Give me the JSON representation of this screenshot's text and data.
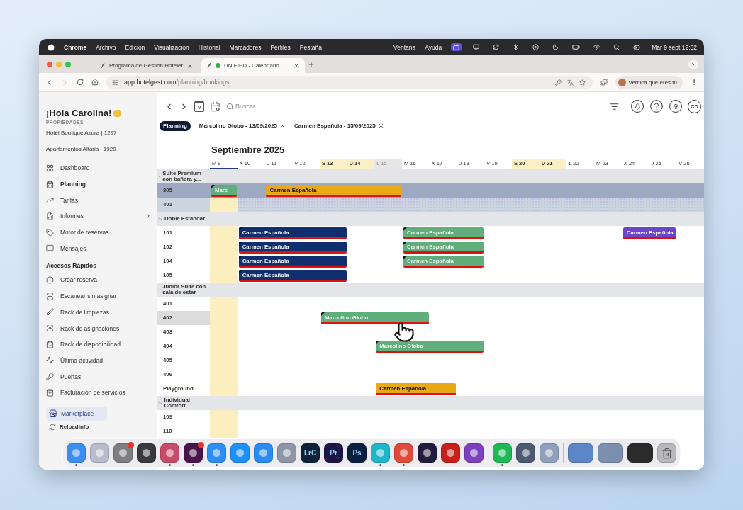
{
  "menu_bar": {
    "app": "Chrome",
    "menus": [
      "Archivo",
      "Edición",
      "Visualización",
      "Historial",
      "Marcadores",
      "Perfiles",
      "Pestaña"
    ],
    "right_menus": [
      "Ventana",
      "Ayuda"
    ],
    "clock": "Mar 9 sept 12:52"
  },
  "browser": {
    "tabs": [
      {
        "title": "Programa de Gestión Hoteler",
        "selected": false
      },
      {
        "title": "UNIFIED - Calendario",
        "selected": true
      }
    ],
    "url_host": "app.hotelgest.com",
    "url_path": "/planning/bookings",
    "profile": "Verifica que eres tú"
  },
  "sidebar": {
    "greeting": "¡Hola Carolina!",
    "section": "PROPIEDADES",
    "properties": [
      "Hotel Boutique Azura | 1297",
      "Apartamentos Altaria | 1920"
    ],
    "nav": [
      {
        "label": "Dashboard",
        "selected": false,
        "submenu": false
      },
      {
        "label": "Planning",
        "selected": true,
        "submenu": false
      },
      {
        "label": "Tarifas",
        "selected": false,
        "submenu": false
      },
      {
        "label": "Informes",
        "selected": false,
        "submenu": true
      },
      {
        "label": "Motor de reservas",
        "selected": false,
        "submenu": false
      },
      {
        "label": "Mensajes",
        "selected": false,
        "submenu": false
      }
    ],
    "quick_title": "Accesos Rápidos",
    "quick": [
      "Crear reserva",
      "Escanear sin asignar",
      "Rack de limpiezas",
      "Rack de asignaciones",
      "Rack de disponibilidad",
      "Última actividad",
      "Puertas",
      "Facturación de servicios"
    ],
    "marketplace": {
      "label": "Marketplace",
      "selected": true
    },
    "reload": "ReloadInfo"
  },
  "toolbar": {
    "calendar_day": "9",
    "search_placeholder": "Buscar...",
    "avatar": "CD"
  },
  "page_tabs": [
    {
      "label": "Planning",
      "selected": true,
      "closable": false
    },
    {
      "label": "Marcolino Globo - 13/09/2025",
      "selected": false,
      "closable": true
    },
    {
      "label": "Carmen Española - 15/09/2025",
      "selected": false,
      "closable": true
    }
  ],
  "calendar": {
    "month": "Septiembre 2025",
    "days": [
      {
        "label": "M 9",
        "kind": "today"
      },
      {
        "label": "X 10",
        "kind": "normal"
      },
      {
        "label": "J 11",
        "kind": "normal"
      },
      {
        "label": "V 12",
        "kind": "normal"
      },
      {
        "label": "S 13",
        "kind": "weekend"
      },
      {
        "label": "D 14",
        "kind": "weekend"
      },
      {
        "label": "L 15",
        "kind": "closed"
      },
      {
        "label": "M 16",
        "kind": "normal"
      },
      {
        "label": "X 17",
        "kind": "normal"
      },
      {
        "label": "J 18",
        "kind": "normal"
      },
      {
        "label": "V 19",
        "kind": "normal"
      },
      {
        "label": "S 20",
        "kind": "weekend"
      },
      {
        "label": "D 21",
        "kind": "weekend"
      },
      {
        "label": "L 22",
        "kind": "normal"
      },
      {
        "label": "M 23",
        "kind": "normal"
      },
      {
        "label": "X 24",
        "kind": "normal"
      },
      {
        "label": "J 25",
        "kind": "normal"
      },
      {
        "label": "V 26",
        "kind": "normal"
      }
    ],
    "rows": [
      {
        "kind": "group",
        "label": "Suite Premium con bañera y...",
        "expanded": true
      },
      {
        "kind": "room",
        "label": "305",
        "selected": true,
        "blocked": false,
        "hovered": false,
        "days": [
          {
            "kind": "start",
            "guest": "Marc",
            "color": "#5fae7c",
            "flag": true
          },
          {
            "kind": "free"
          },
          {
            "kind": "start",
            "guest": "Carmen Española",
            "color": "#e8a915",
            "flag": false
          },
          {
            "kind": "stay"
          },
          {
            "kind": "stay"
          },
          {
            "kind": "stay"
          },
          {
            "kind": "stay"
          }
        ]
      },
      {
        "kind": "room",
        "label": "401",
        "selected": false,
        "blocked": true,
        "hovered": false
      },
      {
        "kind": "group",
        "label": "Doble Estándar",
        "expanded": true
      },
      {
        "kind": "room",
        "label": "101",
        "selected": false,
        "blocked": false,
        "hovered": false,
        "days": [
          {
            "kind": "free"
          },
          {
            "kind": "start",
            "guest": "Carmen Española",
            "color": "#0f2f6e",
            "flag": true
          },
          {
            "kind": "stay"
          },
          {
            "kind": "stay"
          },
          {
            "kind": "stay"
          },
          {
            "kind": "free"
          },
          {
            "kind": "free"
          },
          {
            "kind": "start",
            "guest": "Carmen Española",
            "color": "#5fae7c",
            "flag": true
          },
          {
            "kind": "stay"
          },
          {
            "kind": "stay"
          },
          {
            "kind": "free"
          },
          {
            "kind": "free"
          },
          {
            "kind": "free"
          },
          {
            "kind": "free"
          },
          {
            "kind": "free"
          },
          {
            "kind": "start",
            "guest": "Carmen Española",
            "color": "#6b46c9",
            "flag": false
          },
          {
            "kind": "stay"
          }
        ]
      },
      {
        "kind": "room",
        "label": "102",
        "selected": false,
        "blocked": false,
        "hovered": false,
        "days": [
          {
            "kind": "free"
          },
          {
            "kind": "start",
            "guest": "Carmen Española",
            "color": "#0f2f6e",
            "flag": true
          },
          {
            "kind": "stay"
          },
          {
            "kind": "stay"
          },
          {
            "kind": "stay"
          },
          {
            "kind": "free"
          },
          {
            "kind": "free"
          },
          {
            "kind": "start",
            "guest": "Carmen Española",
            "color": "#5fae7c",
            "flag": true
          },
          {
            "kind": "stay"
          },
          {
            "kind": "stay"
          }
        ]
      },
      {
        "kind": "room",
        "label": "104",
        "selected": false,
        "blocked": false,
        "hovered": false,
        "days": [
          {
            "kind": "free"
          },
          {
            "kind": "start",
            "guest": "Carmen Española",
            "color": "#0f2f6e",
            "flag": true
          },
          {
            "kind": "stay"
          },
          {
            "kind": "stay"
          },
          {
            "kind": "stay"
          },
          {
            "kind": "free"
          },
          {
            "kind": "free"
          },
          {
            "kind": "start",
            "guest": "Carmen Española",
            "color": "#5fae7c",
            "flag": true
          },
          {
            "kind": "stay"
          },
          {
            "kind": "stay"
          }
        ]
      },
      {
        "kind": "room",
        "label": "105",
        "selected": false,
        "blocked": false,
        "hovered": false,
        "days": [
          {
            "kind": "free"
          },
          {
            "kind": "start",
            "guest": "Carmen Española",
            "color": "#0f2f6e",
            "flag": true
          },
          {
            "kind": "stay"
          },
          {
            "kind": "stay"
          },
          {
            "kind": "stay"
          }
        ]
      },
      {
        "kind": "group",
        "label": "Junior Suite con sala de estar",
        "expanded": true
      },
      {
        "kind": "room",
        "label": "401",
        "selected": false,
        "blocked": false,
        "hovered": false
      },
      {
        "kind": "room",
        "label": "402",
        "selected": false,
        "blocked": false,
        "hovered": true,
        "days": [
          {
            "kind": "free"
          },
          {
            "kind": "free"
          },
          {
            "kind": "free"
          },
          {
            "kind": "free"
          },
          {
            "kind": "start",
            "guest": "Marcolino Globo",
            "color": "#5fae7c",
            "flag": true
          },
          {
            "kind": "stay"
          },
          {
            "kind": "stay"
          },
          {
            "kind": "stay"
          }
        ]
      },
      {
        "kind": "room",
        "label": "403",
        "selected": false,
        "blocked": false,
        "hovered": false
      },
      {
        "kind": "room",
        "label": "404",
        "selected": false,
        "blocked": false,
        "hovered": false,
        "days": [
          {
            "kind": "free"
          },
          {
            "kind": "free"
          },
          {
            "kind": "free"
          },
          {
            "kind": "free"
          },
          {
            "kind": "free"
          },
          {
            "kind": "free"
          },
          {
            "kind": "start",
            "guest": "Marcolino Globo",
            "color": "#5fae7c",
            "flag": true
          },
          {
            "kind": "stay"
          },
          {
            "kind": "stay"
          },
          {
            "kind": "stay"
          }
        ]
      },
      {
        "kind": "room",
        "label": "405",
        "selected": false,
        "blocked": false,
        "hovered": false
      },
      {
        "kind": "room",
        "label": "406",
        "selected": false,
        "blocked": false,
        "hovered": false
      },
      {
        "kind": "room",
        "label": "Playground",
        "selected": false,
        "blocked": false,
        "hovered": false,
        "days": [
          {
            "kind": "free"
          },
          {
            "kind": "free"
          },
          {
            "kind": "free"
          },
          {
            "kind": "free"
          },
          {
            "kind": "free"
          },
          {
            "kind": "free"
          },
          {
            "kind": "start",
            "guest": "Carmen Española",
            "color": "#e8a915",
            "flag": false
          },
          {
            "kind": "stay"
          },
          {
            "kind": "stay"
          }
        ]
      },
      {
        "kind": "group",
        "label": "Individual Comfort",
        "expanded": true
      },
      {
        "kind": "room",
        "label": "109",
        "selected": false,
        "blocked": false,
        "hovered": false
      },
      {
        "kind": "room",
        "label": "110",
        "selected": false,
        "blocked": false,
        "hovered": false
      }
    ]
  },
  "dock": [
    {
      "kind": "app",
      "color": "#3b8df0",
      "running": true,
      "badge": false
    },
    {
      "kind": "app",
      "color": "#b9bccb",
      "running": false,
      "badge": false
    },
    {
      "kind": "app",
      "color": "#7d7d82",
      "running": false,
      "badge": true
    },
    {
      "kind": "app",
      "color": "#3a3a3c",
      "running": false,
      "badge": false
    },
    {
      "kind": "app",
      "color": "#c94a6a",
      "running": true,
      "badge": false
    },
    {
      "kind": "app",
      "color": "#4a154b",
      "running": true,
      "badge": true
    },
    {
      "kind": "app",
      "color": "#2d8ef5",
      "running": true,
      "badge": false
    },
    {
      "kind": "app",
      "color": "#1e90ff",
      "running": false,
      "badge": false
    },
    {
      "kind": "app",
      "color": "#2a8cf3",
      "running": false,
      "badge": false
    },
    {
      "kind": "app",
      "color": "#8d96a8",
      "running": false,
      "badge": false
    },
    {
      "kind": "app",
      "color": "#0d2235",
      "running": false,
      "badge": false,
      "label": "LrC"
    },
    {
      "kind": "app",
      "color": "#1d1447",
      "running": false,
      "badge": false,
      "label": "Pr"
    },
    {
      "kind": "app",
      "color": "#0c1f3f",
      "running": false,
      "badge": false,
      "label": "Ps"
    },
    {
      "kind": "app",
      "color": "#1fb6c9",
      "running": true,
      "badge": false
    },
    {
      "kind": "app",
      "color": "#e04a3a",
      "running": true,
      "badge": false
    },
    {
      "kind": "app",
      "color": "#241a3d",
      "running": false,
      "badge": false
    },
    {
      "kind": "app",
      "color": "#c8201a",
      "running": false,
      "badge": false
    },
    {
      "kind": "app",
      "color": "#7b3fbf",
      "running": false,
      "badge": false
    },
    {
      "kind": "separator"
    },
    {
      "kind": "app",
      "color": "#1db954",
      "running": true,
      "badge": false
    },
    {
      "kind": "app",
      "color": "#4c5a72",
      "running": false,
      "badge": false
    },
    {
      "kind": "app",
      "color": "#8ea0bb",
      "running": false,
      "badge": false
    },
    {
      "kind": "separator"
    },
    {
      "kind": "thumb",
      "color": "#5b87c9",
      "running": false,
      "badge": false
    },
    {
      "kind": "thumb",
      "color": "#7d8fb0",
      "running": false,
      "badge": false
    },
    {
      "kind": "thumb",
      "color": "#2b2b2b",
      "running": false,
      "badge": false
    },
    {
      "kind": "trash",
      "color": "#b8b8be",
      "running": false,
      "badge": false
    }
  ]
}
